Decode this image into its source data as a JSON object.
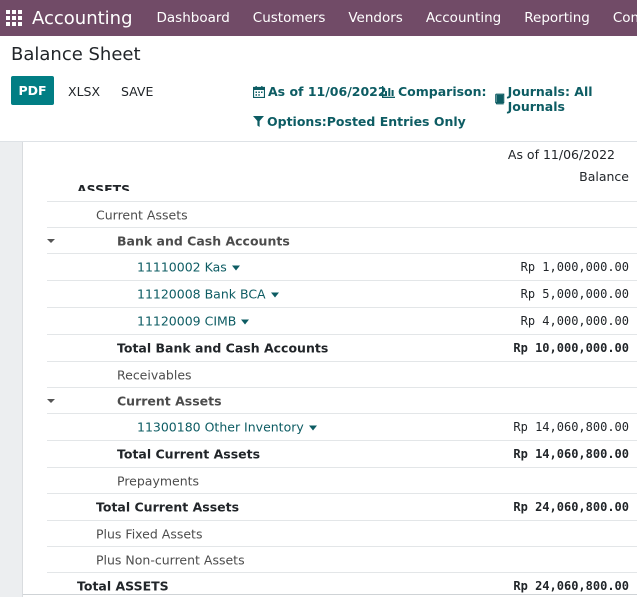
{
  "navbar": {
    "app_name": "Accounting",
    "menu": [
      "Dashboard",
      "Customers",
      "Vendors",
      "Accounting",
      "Reporting",
      "Configuration"
    ]
  },
  "page": {
    "title": "Balance Sheet"
  },
  "toolbar": {
    "pdf_label": "PDF",
    "xlsx_label": "XLSX",
    "save_label": "SAVE"
  },
  "filters": {
    "date_label": "As of 11/06/2022",
    "comparison_label": "Comparison:",
    "journals_label": "Journals: All Journals",
    "options_label": "Options:Posted Entries Only"
  },
  "report": {
    "column_date": "As of 11/06/2022",
    "column_balance": "Balance",
    "section_title": "ASSETS",
    "lines": [
      {
        "label": "Current Assets",
        "amount": ""
      },
      {
        "label": "Bank and Cash Accounts",
        "amount": ""
      },
      {
        "label": "11110002 Kas",
        "amount": "Rp 1,000,000.00"
      },
      {
        "label": "11120008 Bank BCA",
        "amount": "Rp 5,000,000.00"
      },
      {
        "label": "11120009 CIMB",
        "amount": "Rp 4,000,000.00"
      },
      {
        "label": "Total Bank and Cash Accounts",
        "amount": "Rp 10,000,000.00"
      },
      {
        "label": "Receivables",
        "amount": ""
      },
      {
        "label": "Current Assets",
        "amount": ""
      },
      {
        "label": "11300180 Other Inventory",
        "amount": "Rp 14,060,800.00"
      },
      {
        "label": "Total Current Assets",
        "amount": "Rp 14,060,800.00"
      },
      {
        "label": "Prepayments",
        "amount": ""
      },
      {
        "label": "Total Current Assets",
        "amount": "Rp 24,060,800.00"
      },
      {
        "label": "Plus Fixed Assets",
        "amount": ""
      },
      {
        "label": "Plus Non-current Assets",
        "amount": ""
      },
      {
        "label": "Total ASSETS",
        "amount": "Rp 24,060,800.00"
      }
    ]
  },
  "colors": {
    "navbar": "#714b67",
    "primary_button": "#017e84",
    "link": "#0d5c63"
  }
}
